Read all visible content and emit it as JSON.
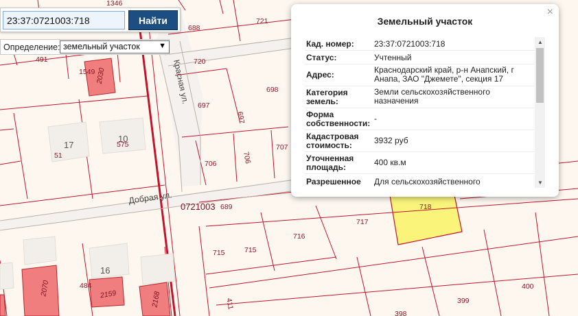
{
  "search": {
    "value": "23:37:0721003:718",
    "button_label": "Найти"
  },
  "definition": {
    "label": "Определение:",
    "selected": "земельный участок"
  },
  "popup": {
    "title": "Земельный участок",
    "close": "×",
    "rows": [
      {
        "key": "Кад. номер:",
        "value": "23:37:0721003:718"
      },
      {
        "key": "Статус:",
        "value": "Учтенный"
      },
      {
        "key": "Адрес:",
        "value": "Краснодарский край, р-н Анапский, г Анапа, ЗАО \"Джемете\", секция 17"
      },
      {
        "key": "Категория земель:",
        "value": "Земли сельскохозяйственного назначения"
      },
      {
        "key": "Форма собственности:",
        "value": "-"
      },
      {
        "key": "Кадастровая стоимость:",
        "value": "3932 руб"
      },
      {
        "key": "Уточненная площадь:",
        "value": "400 кв.м"
      },
      {
        "key": "Разрешенное",
        "value": "Для сельскохозяйственного"
      }
    ]
  },
  "map": {
    "streets": [
      "Красная ул.",
      "Добрая ул."
    ],
    "block_number": "0721003",
    "selected_parcel_label": "718",
    "parcel_labels": [
      "688",
      "721",
      "720",
      "698",
      "697",
      "697",
      "706",
      "706",
      "707",
      "689",
      "491",
      "1549",
      "1346",
      "17",
      "51",
      "10",
      "575",
      "717",
      "716",
      "715",
      "715",
      "16",
      "484",
      "411",
      "400",
      "399",
      "398"
    ],
    "building_labels": [
      "2030",
      "2070",
      "2159",
      "2168"
    ],
    "colors": {
      "background": "#fdf7f0",
      "parcel_line": "#c0142c",
      "label": "#8a1a2a",
      "selected_parcel": "#faf57a",
      "building": "#f07e7e",
      "house_gray": "#f2efeb"
    }
  }
}
